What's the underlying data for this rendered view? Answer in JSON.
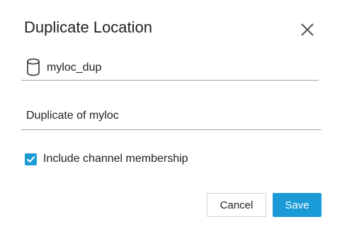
{
  "dialog": {
    "title": "Duplicate Location",
    "close_icon": "close-icon"
  },
  "fields": {
    "name": {
      "icon": "database-icon",
      "value": "myloc_dup"
    },
    "description": {
      "value": "Duplicate of myloc"
    }
  },
  "options": {
    "include_membership": {
      "label": "Include channel membership",
      "checked": true
    }
  },
  "buttons": {
    "cancel": "Cancel",
    "save": "Save"
  },
  "colors": {
    "accent": "#1a9bd7",
    "text": "#212121",
    "divider": "#9e9e9e"
  }
}
